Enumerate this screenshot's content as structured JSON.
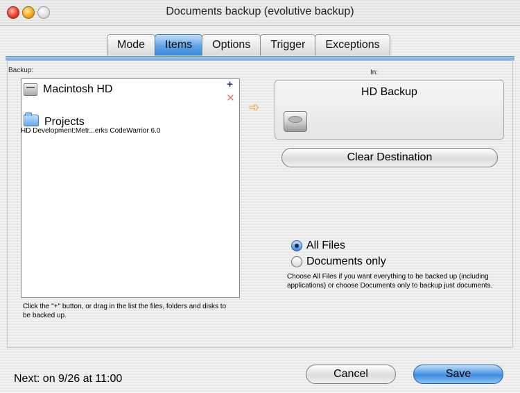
{
  "window": {
    "title": "Documents backup (evolutive backup)"
  },
  "tabs": [
    "Mode",
    "Items",
    "Options",
    "Trigger",
    "Exceptions"
  ],
  "active_tab": "Items",
  "left": {
    "label": "Backup:",
    "items": [
      {
        "label": "Macintosh HD",
        "icon": "hard-disk-icon"
      },
      {
        "label": "Projects",
        "icon": "folder-icon",
        "path": "HD Development:Metr...erks CodeWarrior 6.0"
      }
    ],
    "hint": "Click the \"+\" button, or drag in the list the files, folders and disks to be backed up.",
    "add_symbol": "+",
    "remove_symbol": "✕"
  },
  "right": {
    "label": "In:",
    "destination_name": "HD Backup",
    "clear_label": "Clear Destination",
    "radio_all": "All Files",
    "radio_docs": "Documents only",
    "help": "Choose All Files if you want everything to be backed up (including applications) or choose Documents only to backup just documents."
  },
  "footer": {
    "next": "Next: on 9/26 at 11:00",
    "cancel": "Cancel",
    "save": "Save"
  },
  "colors": {
    "accent": "#3f8bde",
    "arrow": "#f0a53a"
  }
}
